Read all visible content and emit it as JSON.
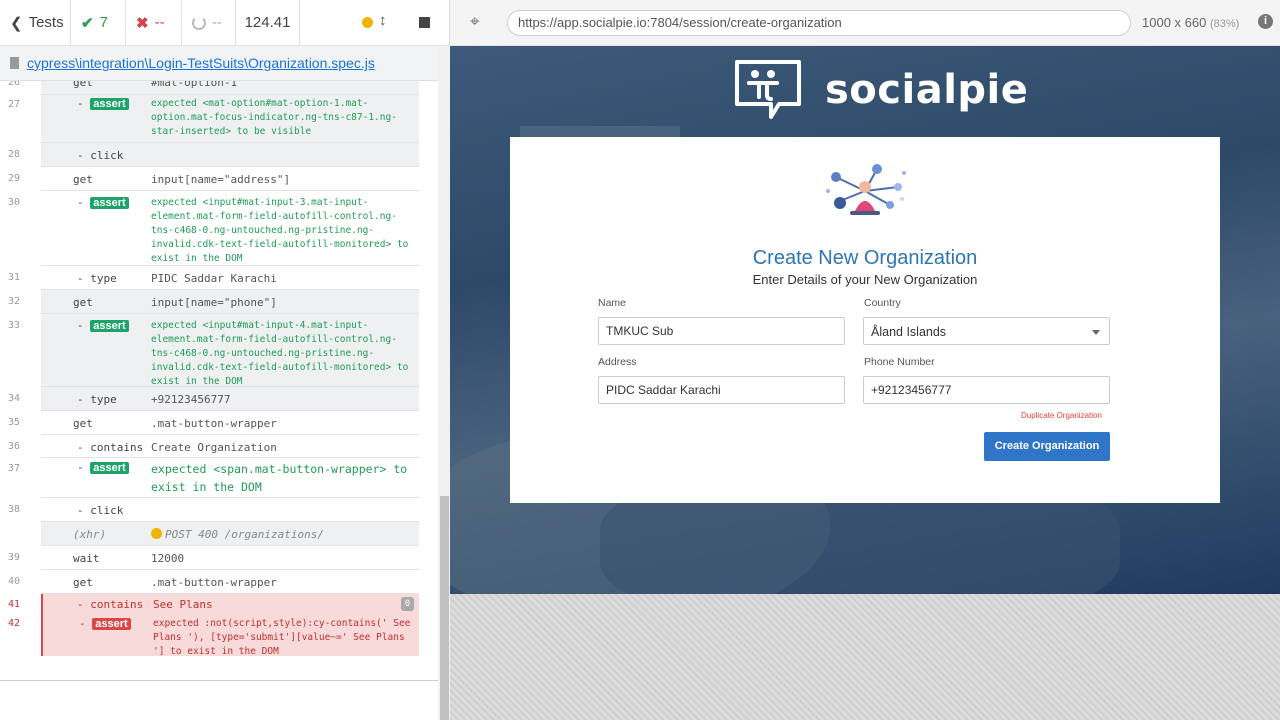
{
  "runner": {
    "back_label": "Tests",
    "passed": "7",
    "failed": "--",
    "pending": "--",
    "duration": "124.41"
  },
  "spec": {
    "path": "cypress\\integration\\Login-TestSuits\\Organization.spec.js"
  },
  "commands": [
    {
      "num": "26",
      "name": "get",
      "msg": "#mat-option-1"
    },
    {
      "num": "27",
      "name": "- assert",
      "msg": "expected <mat-option#mat-option-1.mat-option.mat-focus-indicator.ng-tns-c87-1.ng-star-inserted> to be visible",
      "type": "assert"
    },
    {
      "num": "28",
      "name": "- click",
      "msg": ""
    },
    {
      "num": "29",
      "name": "get",
      "msg": "input[name=\"address\"]"
    },
    {
      "num": "30",
      "name": "- assert",
      "msg": "expected <input#mat-input-3.mat-input-element.mat-form-field-autofill-control.ng-tns-c468-0.ng-untouched.ng-pristine.ng-invalid.cdk-text-field-autofill-monitored> to exist in the DOM",
      "type": "assert"
    },
    {
      "num": "31",
      "name": "- type",
      "msg": "PIDC Saddar Karachi"
    },
    {
      "num": "32",
      "name": "get",
      "msg": "input[name=\"phone\"]"
    },
    {
      "num": "33",
      "name": "- assert",
      "msg": "expected <input#mat-input-4.mat-input-element.mat-form-field-autofill-control.ng-tns-c468-0.ng-untouched.ng-pristine.ng-invalid.cdk-text-field-autofill-monitored> to exist in the DOM",
      "type": "assert"
    },
    {
      "num": "34",
      "name": "- type",
      "msg": "+92123456777"
    },
    {
      "num": "35",
      "name": "get",
      "msg": ".mat-button-wrapper"
    },
    {
      "num": "36",
      "name": "- contains",
      "msg": "Create Organization"
    },
    {
      "num": "37",
      "name": "- assert",
      "msg": "expected <span.mat-button-wrapper> to exist in the DOM",
      "type": "assert-big"
    },
    {
      "num": "38",
      "name": "- click",
      "msg": ""
    },
    {
      "num": "",
      "name": "(xhr)",
      "msg": "POST 400 /organizations/",
      "type": "xhr"
    },
    {
      "num": "39",
      "name": "wait",
      "msg": "12000"
    },
    {
      "num": "40",
      "name": "get",
      "msg": ".mat-button-wrapper"
    },
    {
      "num": "41",
      "name": "- contains",
      "msg": "See Plans",
      "type": "err"
    },
    {
      "num": "42",
      "name": "- assert",
      "msg": "expected :not(script,style):cy-contains(' See Plans '), [type='submit'][value~=' See Plans '] to exist in the DOM",
      "type": "err-assert"
    }
  ],
  "err_badge": "0",
  "browser": {
    "url": "https://app.socialpie.io:7804/session/create-organization",
    "viewport": "1000 x 660",
    "zoom": "(83%)"
  },
  "app": {
    "logo_text": "socialpie",
    "title": "Create New Organization",
    "subtitle": "Enter Details of your New Organization",
    "name_label": "Name",
    "name_value": "TMKUC Sub",
    "country_label": "Country",
    "country_value": "Åland Islands",
    "address_label": "Address",
    "address_value": "PIDC Saddar Karachi",
    "phone_label": "Phone Number",
    "phone_value": "+92123456777",
    "error_text": "Duplicate Organization",
    "submit_label": "Create Organization"
  },
  "colors": {
    "accent": "#2f75c8",
    "pass": "#1ea36a",
    "fail": "#d94848"
  }
}
